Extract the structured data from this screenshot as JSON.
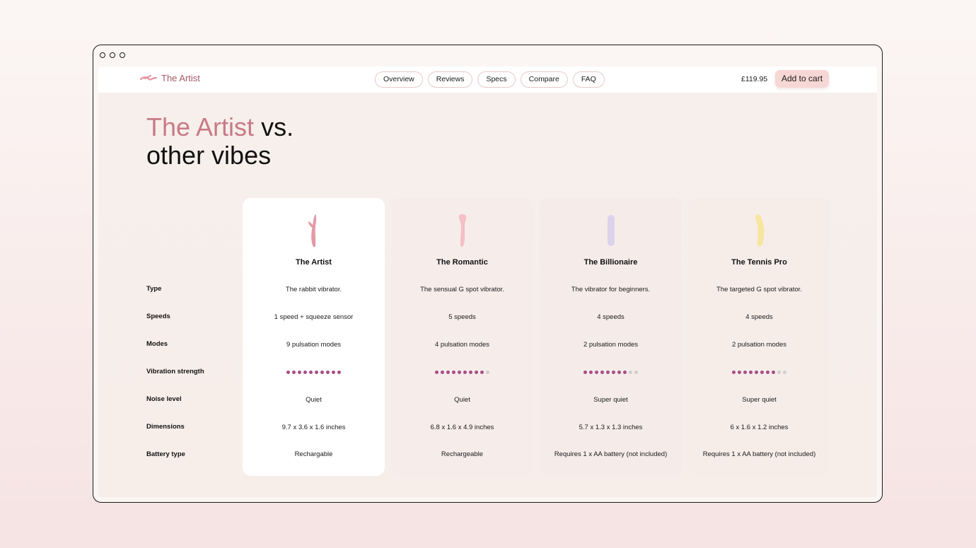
{
  "brand": {
    "name": "The Artist",
    "icon": "squiggle-logo-icon",
    "color": "#a35b66"
  },
  "nav": {
    "tabs": [
      "Overview",
      "Reviews",
      "Specs",
      "Compare",
      "FAQ"
    ],
    "price": "£119.95",
    "cart_label": "Add to cart"
  },
  "headline": {
    "accent": "The Artist",
    "rest": " vs.",
    "line2": "other vibes",
    "accent_color": "#c97a85"
  },
  "rows": {
    "type": "Type",
    "speeds": "Speeds",
    "modes": "Modes",
    "vibration": "Vibration strength",
    "noise": "Noise level",
    "dimensions": "Dimensions",
    "battery": "Battery type"
  },
  "products": [
    {
      "name": "The Artist",
      "icon": "rabbit-vibrator-icon",
      "icon_color": "#e39aa6",
      "type": "The rabbit vibrator.",
      "speeds": "1 speed + squeeze sensor",
      "modes": "9 pulsation modes",
      "vibration_level": 10,
      "vibration_max": 10,
      "noise": "Quiet",
      "dimensions": "9.7 x 3.6 x 1.6 inches",
      "battery": "Rechargable"
    },
    {
      "name": "The Romantic",
      "icon": "g-spot-vibrator-icon",
      "icon_color": "#f4bfc6",
      "type": "The sensual G spot vibrator.",
      "speeds": "5 speeds",
      "modes": "4 pulsation modes",
      "vibration_level": 9,
      "vibration_max": 10,
      "noise": "Quiet",
      "dimensions": "6.8 x 1.6 x 4.9 inches",
      "battery": "Rechargeable"
    },
    {
      "name": "The Billionaire",
      "icon": "bullet-vibrator-icon",
      "icon_color": "#dcd2ec",
      "type": "The vibrator for beginners.",
      "speeds": "4 speeds",
      "modes": "2 pulsation modes",
      "vibration_level": 8,
      "vibration_max": 10,
      "noise": "Super quiet",
      "dimensions": "5.7 x 1.3 x 1.3 inches",
      "battery": "Requires 1 x AA battery (not included)"
    },
    {
      "name": "The Tennis Pro",
      "icon": "curved-vibrator-icon",
      "icon_color": "#f6e6a0",
      "type": "The targeted G spot vibrator.",
      "speeds": "4 speeds",
      "modes": "2 pulsation modes",
      "vibration_level": 8,
      "vibration_max": 10,
      "noise": "Super quiet",
      "dimensions": "6 x 1.6 x 1.2 inches",
      "battery": "Requires 1 x AA battery (not included)"
    }
  ],
  "colors": {
    "dot_on": "#a84f86",
    "dot_off": "#cfcfcf",
    "cart_bg": "#f7d7d5"
  }
}
